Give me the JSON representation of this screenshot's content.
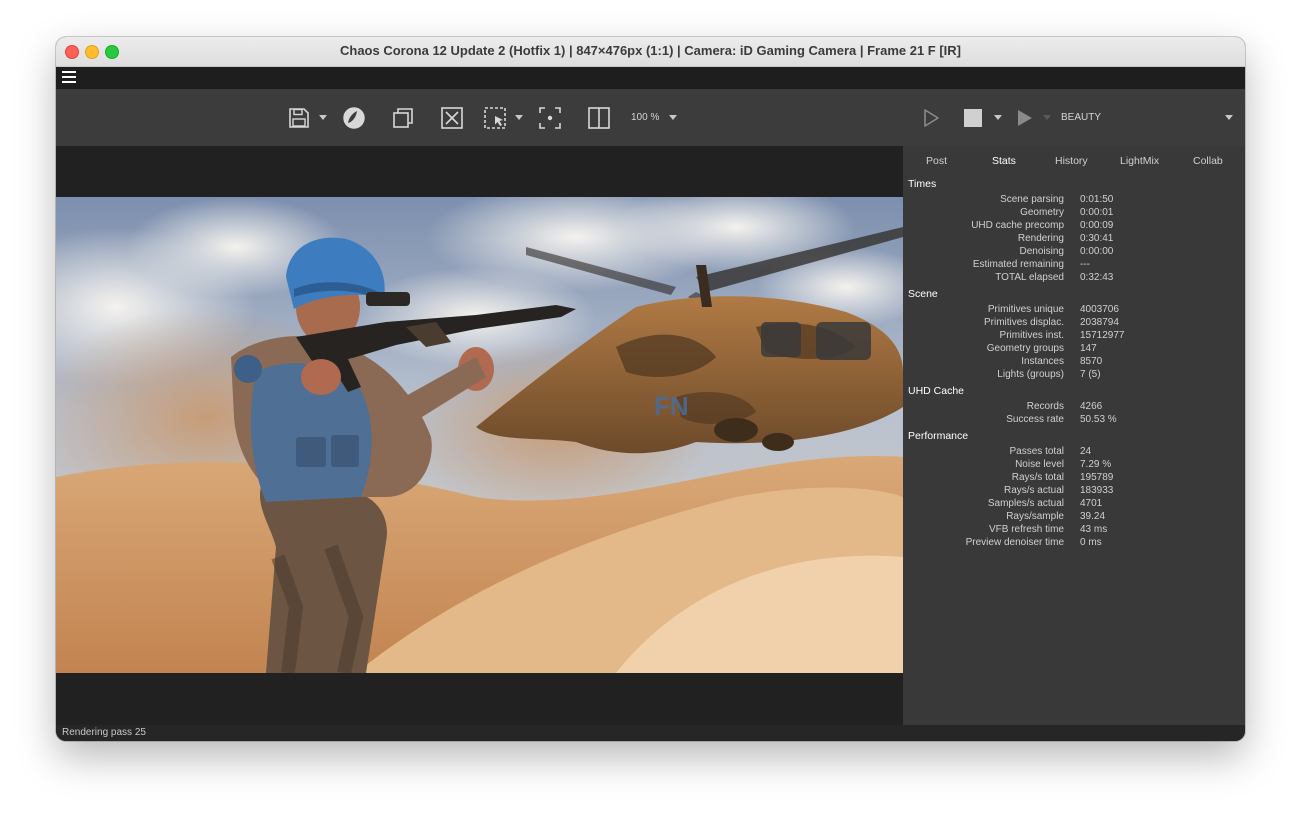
{
  "window": {
    "title": "Chaos Corona 12 Update 2 (Hotfix 1) | 847×476px (1:1) | Camera: iD Gaming Camera | Frame 21 F [IR]"
  },
  "toolbar": {
    "zoom_label": "100 %",
    "channel_label": "BEAUTY"
  },
  "panel": {
    "tabs": [
      {
        "label": "Post"
      },
      {
        "label": "Stats"
      },
      {
        "label": "History"
      },
      {
        "label": "LightMix"
      },
      {
        "label": "Collab"
      }
    ],
    "active_tab": "Stats",
    "sections": [
      {
        "title": "Times",
        "rows": [
          {
            "label": "Scene parsing",
            "value": "0:01:50"
          },
          {
            "label": "Geometry",
            "value": "0:00:01"
          },
          {
            "label": "UHD cache precomp",
            "value": "0:00:09"
          },
          {
            "label": "Rendering",
            "value": "0:30:41"
          },
          {
            "label": "Denoising",
            "value": "0:00:00"
          },
          {
            "label": "Estimated remaining",
            "value": "---"
          },
          {
            "label": "TOTAL elapsed",
            "value": "0:32:43"
          }
        ]
      },
      {
        "title": "Scene",
        "rows": [
          {
            "label": "Primitives unique",
            "value": "4003706"
          },
          {
            "label": "Primitives displac.",
            "value": "2038794"
          },
          {
            "label": "Primitives inst.",
            "value": "15712977"
          },
          {
            "label": "Geometry groups",
            "value": "147"
          },
          {
            "label": "Instances",
            "value": "8570"
          },
          {
            "label": "Lights (groups)",
            "value": "7 (5)"
          }
        ]
      },
      {
        "title": "UHD Cache",
        "rows": [
          {
            "label": "Records",
            "value": "4266"
          },
          {
            "label": "Success rate",
            "value": "50.53 %"
          }
        ]
      },
      {
        "title": "Performance",
        "rows": [
          {
            "label": "Passes total",
            "value": "24"
          },
          {
            "label": "Noise level",
            "value": "7.29 %"
          },
          {
            "label": "Rays/s total",
            "value": "195789"
          },
          {
            "label": "Rays/s actual",
            "value": "183933"
          },
          {
            "label": "Samples/s actual",
            "value": "4701"
          },
          {
            "label": "Rays/sample",
            "value": "39.24"
          },
          {
            "label": "VFB refresh time",
            "value": "43 ms"
          },
          {
            "label": "Preview denoiser time",
            "value": "0 ms"
          }
        ]
      }
    ]
  },
  "status": {
    "text": "Rendering pass 25"
  },
  "render": {
    "decal_text": "FN"
  }
}
